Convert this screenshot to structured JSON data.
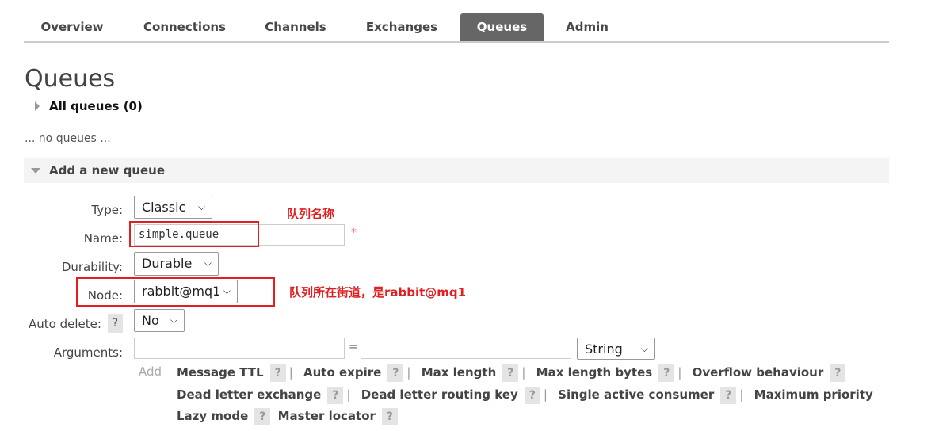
{
  "tabs": [
    "Overview",
    "Connections",
    "Channels",
    "Exchanges",
    "Queues",
    "Admin"
  ],
  "active_tab": "Queues",
  "page_title": "Queues",
  "all_queues": "All queues (0)",
  "no_queues": "... no queues ...",
  "add_section": "Add a new queue",
  "form": {
    "type_label": "Type:",
    "type_value": "Classic",
    "name_label": "Name:",
    "name_value": "simple.queue",
    "required": "*",
    "durability_label": "Durability:",
    "durability_value": "Durable",
    "node_label": "Node:",
    "node_value": "rabbit@mq1",
    "auto_delete_label": "Auto delete:",
    "auto_delete_value": "No",
    "help": "?",
    "arguments_label": "Arguments:",
    "equals": "=",
    "arg_type": "String",
    "add": "Add"
  },
  "annotations": {
    "name": "队列名称",
    "node": "队列所在街道，是rabbit@mq1"
  },
  "arg_rows": [
    [
      "Message TTL",
      "Auto expire",
      "Max length",
      "Max length bytes",
      "Overflow behaviour"
    ],
    [
      "Dead letter exchange",
      "Dead letter routing key",
      "Single active consumer",
      "Maximum priority"
    ],
    [
      "Lazy mode",
      "Master locator"
    ]
  ]
}
